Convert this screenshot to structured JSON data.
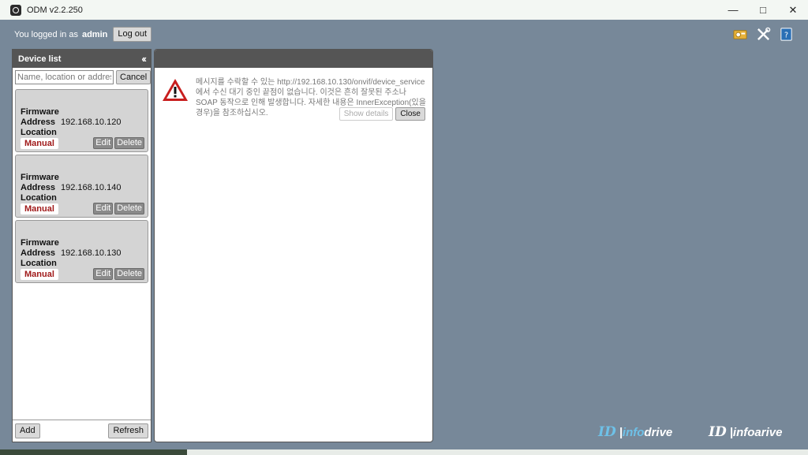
{
  "window": {
    "title": "ODM v2.2.250"
  },
  "session": {
    "logged_in_prefix": "You logged in as",
    "username": "admin",
    "logout_label": "Log out"
  },
  "device_list": {
    "title": "Device list",
    "search_placeholder": "Name, location or address",
    "cancel_label": "Cancel",
    "devices": [
      {
        "firmware_label": "Firmware",
        "address_label": "Address",
        "address": "192.168.10.120",
        "location_label": "Location",
        "badge": "Manual",
        "edit_label": "Edit",
        "delete_label": "Delete"
      },
      {
        "firmware_label": "Firmware",
        "address_label": "Address",
        "address": "192.168.10.140",
        "location_label": "Location",
        "badge": "Manual",
        "edit_label": "Edit",
        "delete_label": "Delete"
      },
      {
        "firmware_label": "Firmware",
        "address_label": "Address",
        "address": "192.168.10.130",
        "location_label": "Location",
        "badge": "Manual",
        "edit_label": "Edit",
        "delete_label": "Delete"
      }
    ],
    "add_label": "Add",
    "refresh_label": "Refresh"
  },
  "message": {
    "text": "메시지를 수락할 수 있는 http://192.168.10.130/onvif/device_service에서 수신 대기 중인 끝점이 없습니다. 이것은 흔히 잘못된 주소나 SOAP 동작으로 인해 발생합니다. 자세한 내용은 InnerException(있을 경우)을 참조하십시오.",
    "show_details_label": "Show details",
    "close_label": "Close"
  },
  "branding": {
    "logo1_mark": "ID",
    "logo1_sep": "| ",
    "logo1_info": "info",
    "logo1_drive": "drive",
    "logo2_mark": "ID",
    "logo2_sep": "| ",
    "logo2_text": "infoarive"
  },
  "colors": {
    "background": "#778899",
    "panel_header": "#555555",
    "badge_text": "#a01a1a",
    "brand_accent": "#6ec1e8"
  }
}
